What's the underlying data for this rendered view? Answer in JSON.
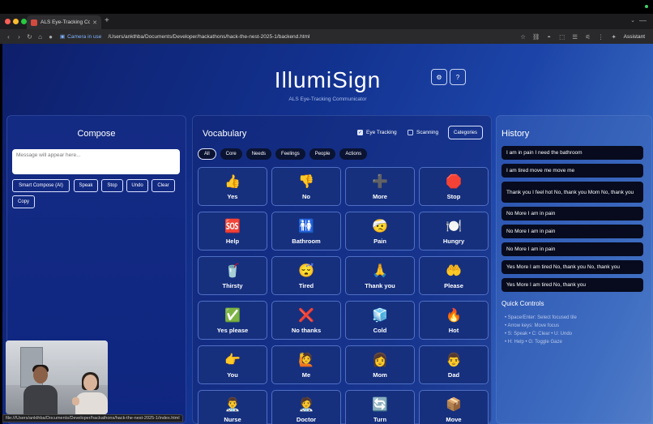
{
  "browser": {
    "tab_title": "ALS Eye-Tracking Communi...",
    "camera_label": "Camera in use",
    "url": "/Users/ankthba/Documents/Developer/hackathons/hack-the-nest-2025-1/backend.html",
    "assistant_label": "Assistant",
    "status_url": "file:///Users/ankthba/Documents/Developer/hackathons/hack-the-nest-2025-1/index.html"
  },
  "header": {
    "title": "IllumiSign",
    "subtitle": "ALS Eye-Tracking Communicator",
    "settings_icon": "settings-icon",
    "help_label": "?"
  },
  "compose": {
    "title": "Compose",
    "placeholder": "Message will appear here...",
    "buttons": [
      "Smart Compose (AI)",
      "Speak",
      "Stop",
      "Undo",
      "Clear",
      "Copy"
    ]
  },
  "vocabulary": {
    "title": "Vocabulary",
    "eye_tracking_label": "Eye Tracking",
    "eye_tracking_checked": true,
    "scanning_label": "Scanning",
    "scanning_checked": false,
    "categories_label": "Categories",
    "filters": [
      "All",
      "Core",
      "Needs",
      "Feelings",
      "People",
      "Actions"
    ],
    "active_filter": "All",
    "tiles": [
      {
        "emoji": "👍",
        "label": "Yes"
      },
      {
        "emoji": "👎",
        "label": "No"
      },
      {
        "emoji": "➕",
        "label": "More"
      },
      {
        "emoji": "🛑",
        "label": "Stop"
      },
      {
        "emoji": "🆘",
        "label": "Help"
      },
      {
        "emoji": "🚻",
        "label": "Bathroom"
      },
      {
        "emoji": "🤕",
        "label": "Pain"
      },
      {
        "emoji": "🍽️",
        "label": "Hungry"
      },
      {
        "emoji": "🥤",
        "label": "Thirsty"
      },
      {
        "emoji": "😴",
        "label": "Tired"
      },
      {
        "emoji": "🙏",
        "label": "Thank you"
      },
      {
        "emoji": "🤲",
        "label": "Please"
      },
      {
        "emoji": "✅",
        "label": "Yes please"
      },
      {
        "emoji": "❌",
        "label": "No thanks"
      },
      {
        "emoji": "🧊",
        "label": "Cold"
      },
      {
        "emoji": "🔥",
        "label": "Hot"
      },
      {
        "emoji": "👉",
        "label": "You"
      },
      {
        "emoji": "🙋",
        "label": "Me"
      },
      {
        "emoji": "👩",
        "label": "Mom"
      },
      {
        "emoji": "👨",
        "label": "Dad"
      },
      {
        "emoji": "👨‍⚕️",
        "label": "Nurse"
      },
      {
        "emoji": "🧑‍⚕️",
        "label": "Doctor"
      },
      {
        "emoji": "🔄",
        "label": "Turn"
      },
      {
        "emoji": "📦",
        "label": "Move"
      }
    ]
  },
  "history": {
    "title": "History",
    "items": [
      "I am in pain I need the bathroom",
      "I am tired move me move me",
      "Thank you I feel hot No, thank you Mom No, thank you",
      "No More I am in pain",
      "No More I am in pain",
      "No More I am in pain",
      "Yes More I am tired No, thank you No, thank you",
      "Yes More I am tired No, thank you"
    ],
    "quick_controls_title": "Quick Controls",
    "quick_controls": [
      "Space/Enter: Select focused tile",
      "Arrow keys: Move focus",
      "S: Speak • C: Clear • U: Undo",
      "H: Help • G: Toggle Gaze"
    ]
  }
}
